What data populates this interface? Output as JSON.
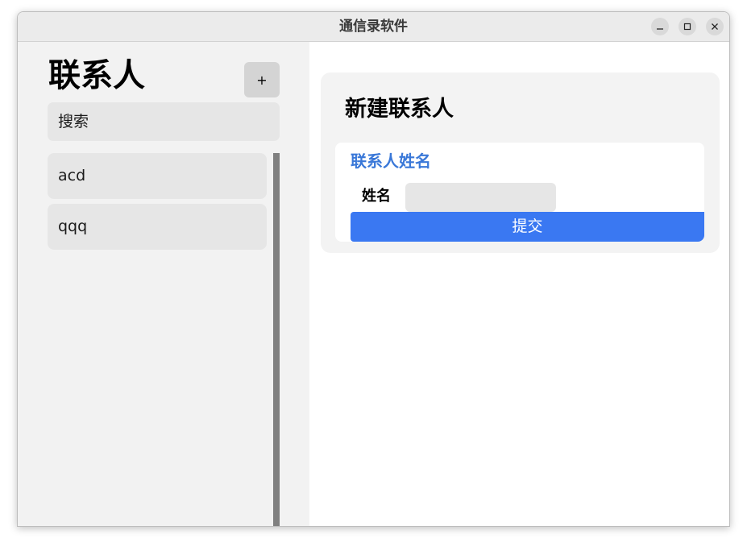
{
  "window": {
    "title": "通信录软件",
    "controls": {
      "minimize": "minimize-icon",
      "maximize": "maximize-icon",
      "close": "close-icon"
    }
  },
  "sidebar": {
    "title": "联系人",
    "add_label": "+",
    "search_placeholder": "搜索",
    "contacts": [
      {
        "name": "acd"
      },
      {
        "name": "qqq"
      }
    ]
  },
  "main": {
    "card_title": "新建联系人",
    "section_label": "联系人姓名",
    "name_field_label": "姓名",
    "name_value": "",
    "submit_label": "提交"
  },
  "colors": {
    "accent": "#3a78f2",
    "section_label": "#3a78d8",
    "sidebar_bg": "#f2f2f2"
  }
}
